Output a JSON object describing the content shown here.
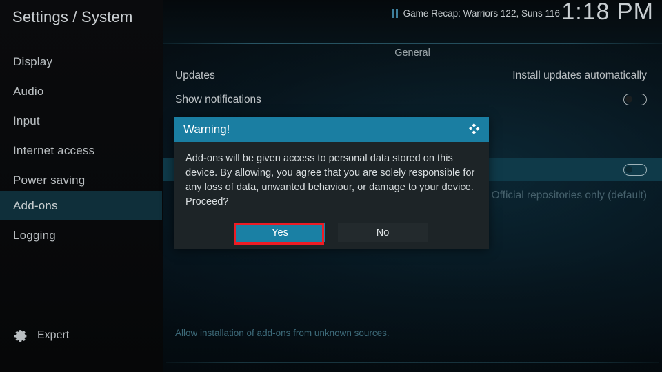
{
  "header": {
    "title": "Settings / System",
    "now_playing": {
      "icon": "pause-icon",
      "text": "Game Recap: Warriors 122, Suns 116"
    },
    "clock": "1:18 PM"
  },
  "sidebar": {
    "items": [
      {
        "label": "Display",
        "selected": false
      },
      {
        "label": "Audio",
        "selected": false
      },
      {
        "label": "Input",
        "selected": false
      },
      {
        "label": "Internet access",
        "selected": false
      },
      {
        "label": "Power saving",
        "selected": false
      },
      {
        "label": "Add-ons",
        "selected": true
      },
      {
        "label": "Logging",
        "selected": false
      }
    ],
    "level": {
      "icon": "gear-icon",
      "label": "Expert"
    }
  },
  "content": {
    "group_header": "General",
    "rows": [
      {
        "label": "Updates",
        "value": "Install updates automatically",
        "control": "text",
        "highlighted": false
      },
      {
        "label": "Show notifications",
        "value": "",
        "control": "toggle-off",
        "highlighted": false
      },
      {
        "label": "",
        "value": "",
        "control": "toggle-off",
        "highlighted": true
      },
      {
        "label": "",
        "value": "Official repositories only (default)",
        "control": "text-dim",
        "highlighted": false
      }
    ],
    "help_text": "Allow installation of add-ons from unknown sources."
  },
  "dialog": {
    "title": "Warning!",
    "logo_icon": "kodi-logo-icon",
    "message": "Add-ons will be given access to personal data stored on this device. By allowing, you agree that you are solely responsible for any loss of data, unwanted behaviour, or damage to your device. Proceed?",
    "buttons": [
      {
        "label": "Yes",
        "focused": true
      },
      {
        "label": "No",
        "focused": false
      }
    ]
  },
  "colors": {
    "accent_teal": "#1a7ea2",
    "selection_teal": "#0f3a49",
    "focus_red": "#ee1c24",
    "dialog_bg": "#1d2427"
  }
}
